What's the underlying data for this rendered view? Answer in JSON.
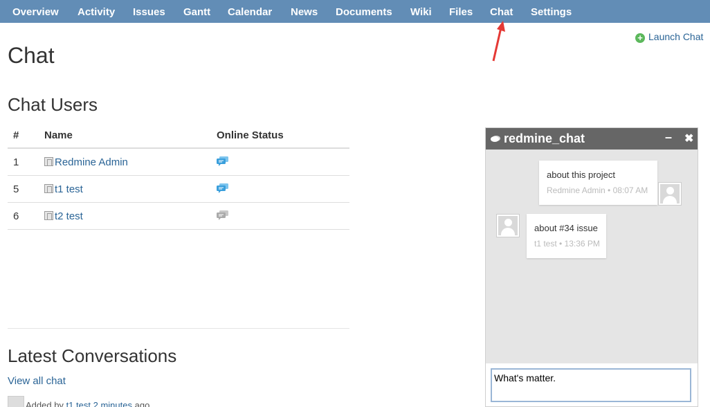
{
  "nav": {
    "items": [
      {
        "label": "Overview"
      },
      {
        "label": "Activity"
      },
      {
        "label": "Issues"
      },
      {
        "label": "Gantt"
      },
      {
        "label": "Calendar"
      },
      {
        "label": "News"
      },
      {
        "label": "Documents"
      },
      {
        "label": "Wiki"
      },
      {
        "label": "Files"
      },
      {
        "label": "Chat"
      },
      {
        "label": "Settings"
      }
    ]
  },
  "launch_chat": "Launch Chat",
  "page_title": "Chat",
  "chat_users": {
    "title": "Chat Users",
    "columns": [
      "#",
      "Name",
      "Online Status"
    ],
    "rows": [
      {
        "num": "1",
        "name": "Redmine Admin",
        "status": "online"
      },
      {
        "num": "5",
        "name": "t1 test",
        "status": "online"
      },
      {
        "num": "6",
        "name": "t2 test",
        "status": "offline"
      }
    ]
  },
  "latest": {
    "title": "Latest Conversations",
    "view_all": "View all chat",
    "added_prefix": "Added by",
    "added_user": "t1 test",
    "added_time": "2 minutes",
    "added_suffix": "ago"
  },
  "chat_window": {
    "title": "redmine_chat",
    "minimize": "–",
    "close": "✖",
    "messages": [
      {
        "text": "about this project",
        "meta": "Redmine Admin • 08:07 AM"
      },
      {
        "text": "about #34 issue",
        "meta": "t1 test • 13:36 PM"
      }
    ],
    "input_value": "What's matter."
  },
  "colors": {
    "nav_bg": "#628db6",
    "link": "#2a6496",
    "online": "#3a9fdc",
    "offline": "#aaaaaa",
    "chat_header": "#666666"
  }
}
